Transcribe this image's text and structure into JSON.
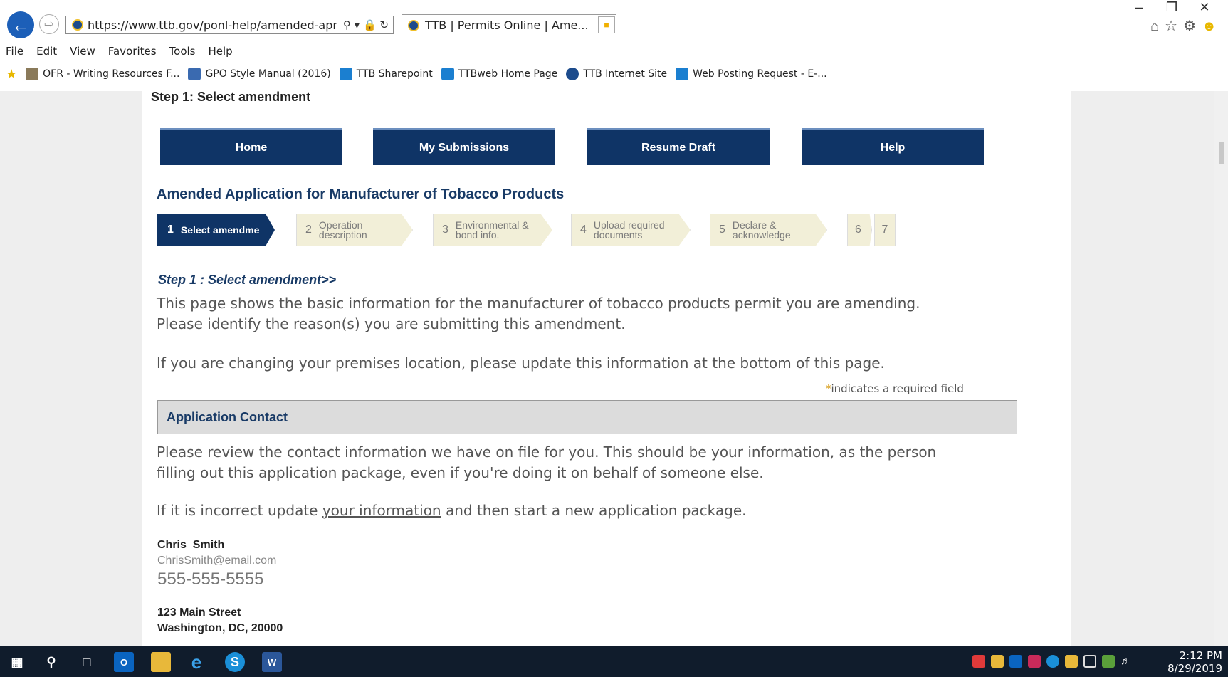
{
  "browser": {
    "address": "https://www.ttb.gov/ponl-help/amended-app",
    "address_display": "https://www.ttb.gov/ponl-help/amended-apr",
    "tab_title": "TTB | Permits Online | Ame...",
    "menu": [
      "File",
      "Edit",
      "View",
      "Favorites",
      "Tools",
      "Help"
    ],
    "favorites": [
      {
        "label": "OFR - Writing Resources F...",
        "icon": "page-icon",
        "color": "#8a7a5a"
      },
      {
        "label": "GPO Style Manual (2016)",
        "icon": "gpo-icon",
        "color": "#3a6ab0"
      },
      {
        "label": "TTB Sharepoint",
        "icon": "sharepoint-icon",
        "color": "#1b7fd0"
      },
      {
        "label": "TTBweb Home Page",
        "icon": "sharepoint-icon",
        "color": "#1b7fd0"
      },
      {
        "label": "TTB Internet Site",
        "icon": "ttb-icon",
        "color": "#1c4b8c"
      },
      {
        "label": "Web Posting Request - E-...",
        "icon": "sharepoint-icon",
        "color": "#1b7fd0"
      }
    ]
  },
  "page": {
    "step_heading": "Step 1: Select amendment",
    "nav": [
      "Home",
      "My Submissions",
      "Resume Draft",
      "Help"
    ],
    "app_title": "Amended Application for Manufacturer of Tobacco Products",
    "steps": [
      {
        "num": "1",
        "label": "Select amendme"
      },
      {
        "num": "2",
        "label": "Operation\ndescription"
      },
      {
        "num": "3",
        "label": "Environmental &\nbond info."
      },
      {
        "num": "4",
        "label": "Upload required\ndocuments"
      },
      {
        "num": "5",
        "label": "Declare &\nacknowledge"
      },
      {
        "num": "6",
        "label": ""
      },
      {
        "num": "7",
        "label": ""
      }
    ],
    "instruction_heading": "Step 1 : Select amendment>>",
    "intro_line1": "This page shows the basic information for the manufacturer of tobacco products permit you are amending.",
    "intro_line2": "Please identify the reason(s) you are submitting this amendment.",
    "premises_note": "If you are changing your premises location, please update this information at the bottom of this page.",
    "required_star": "*",
    "required_note": "indicates a required field",
    "section_title": "Application Contact",
    "contact_text1": "Please review the contact information we have on file for you.  This should be your information, as the person",
    "contact_text2": "filling out this application package, even if you're doing it on behalf of someone else.",
    "update_prefix": "If it is incorrect update ",
    "update_link": "your information",
    "update_suffix": " and then start a new application package.",
    "contact": {
      "name": "Chris  Smith",
      "email": "ChrisSmith@email.com",
      "phone": "555-555-5555",
      "address1": "123 Main Street",
      "address2": "Washington, DC, 20000"
    }
  },
  "taskbar": {
    "time": "2:12 PM",
    "date": "8/29/2019"
  }
}
